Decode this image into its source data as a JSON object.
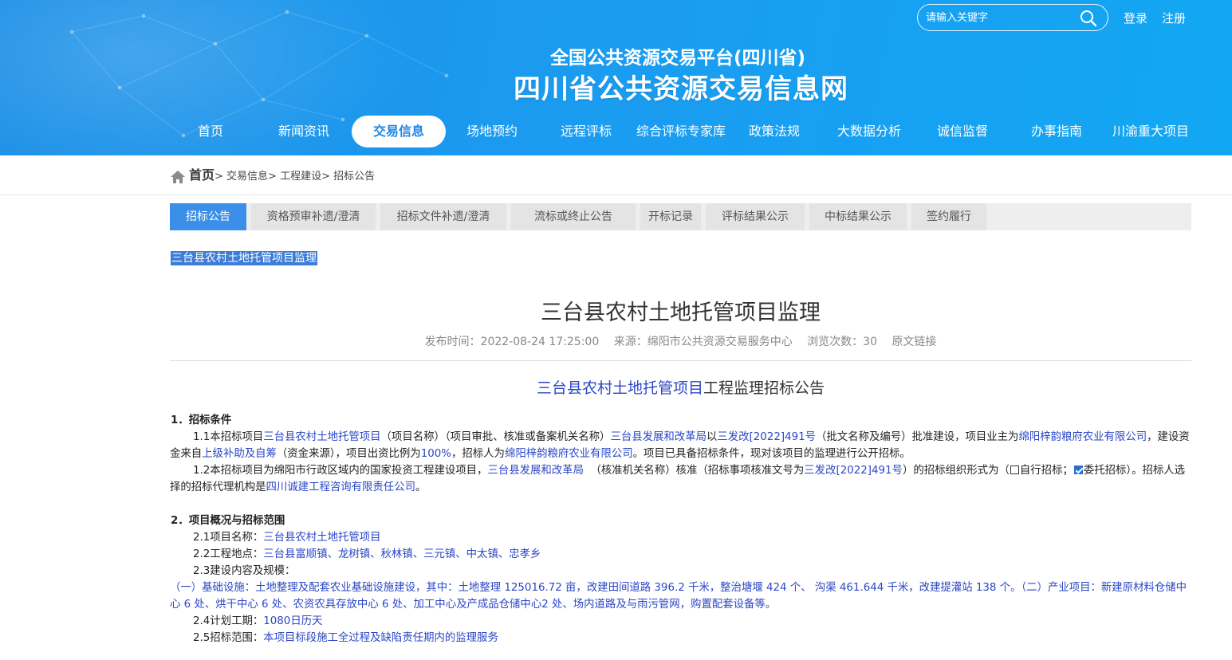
{
  "header": {
    "search_placeholder": "请输入关键字",
    "login": "登录",
    "register": "注册",
    "subtitle": "全国公共资源交易平台(四川省)",
    "site_title": "四川省公共资源交易信息网"
  },
  "nav": {
    "items": [
      "首页",
      "新闻资讯",
      "交易信息",
      "场地预约",
      "远程评标",
      "综合评标专家库",
      "政策法规",
      "大数据分析",
      "诚信监督",
      "办事指南",
      "川渝重大项目"
    ],
    "active": "交易信息"
  },
  "breadcrumb": {
    "home": "首页",
    "c1": "> 交易信息",
    "c2": "> 工程建设",
    "c3": "> 招标公告"
  },
  "tabs": [
    "招标公告",
    "资格预审补遗/澄清",
    "招标文件补遗/澄清",
    "流标或终止公告",
    "开标记录",
    "评标结果公示",
    "中标结果公示",
    "签约履行"
  ],
  "selected_text": "三台县农村土地托管项目监理",
  "article": {
    "title": "三台县农村土地托管项目监理",
    "publish": "发布时间：2022-08-24 17:25:00",
    "source": "来源：绵阳市公共资源交易服务中心",
    "views": "浏览次数：30",
    "original": "原文链接",
    "doc_title_blue": "三台县农村土地托管项目",
    "doc_title_rest": "工程监理招标公告"
  },
  "body": {
    "s1": "1．招标条件",
    "p11": [
      "1.1本招标项目",
      "三台县农村土地托管项目",
      "（项目名称）（项目审批、核准或备案机关名称）",
      "三台县发展和改革局",
      "以",
      "三发改[2022]491号",
      "（批文名称及编号）批准建设，项目业主为",
      "绵阳梓韵粮府农业有限公司",
      "，建设资金来自",
      "上级补助及自筹",
      "（资金来源），项目出资比例为",
      "100%",
      "，招标人为",
      "绵阳梓韵粮府农业有限公司",
      "。项目已具备招标条件，现对该项目的监理进行公开招标。"
    ],
    "p12": [
      "1.2本招标项目为绵阳市行政区域内的国家投资工程建设项目，",
      "三台县发展和改革局",
      "（核准机关名称）核准（招标事项核准文号为",
      "三发改[2022]491号",
      "）的招标组织形式为（",
      "自行招标；",
      "委托招标）。招标人选择的招标代理机构是",
      "四川诚建工程咨询有限责任公司",
      "。"
    ],
    "s2": "2．项目概况与招标范围",
    "p21_label": "2.1项目名称：",
    "p21_value": "三台县农村土地托管项目",
    "p22_label": "2.2工程地点：",
    "p22_value": "三台县富顺镇、龙树镇、秋林镇、三元镇、中太镇、忠孝乡",
    "p23_label": "2.3建设内容及规模：",
    "p23_text": "（一）基础设施：土地整理及配套农业基础设施建设，其中：土地整理 125016.72 亩，改建田间道路 396.2 千米，整治塘堰 424 个、 沟渠 461.644 千米，改建提灌站 138 个。（二）产业项目：新建原材料仓储中心 6 处、烘干中心 6 处、农资农具存放中心 6 处、加工中心及产成品仓储中心2 处、场内道路及与雨污管网，购置配套设备等。",
    "p24_label": "2.4计划工期：",
    "p24_value": "1080日历天",
    "p25_label": "2.5招标范围：",
    "p25_value": "本项目标段施工全过程及缺陷责任期内的监理服务"
  }
}
